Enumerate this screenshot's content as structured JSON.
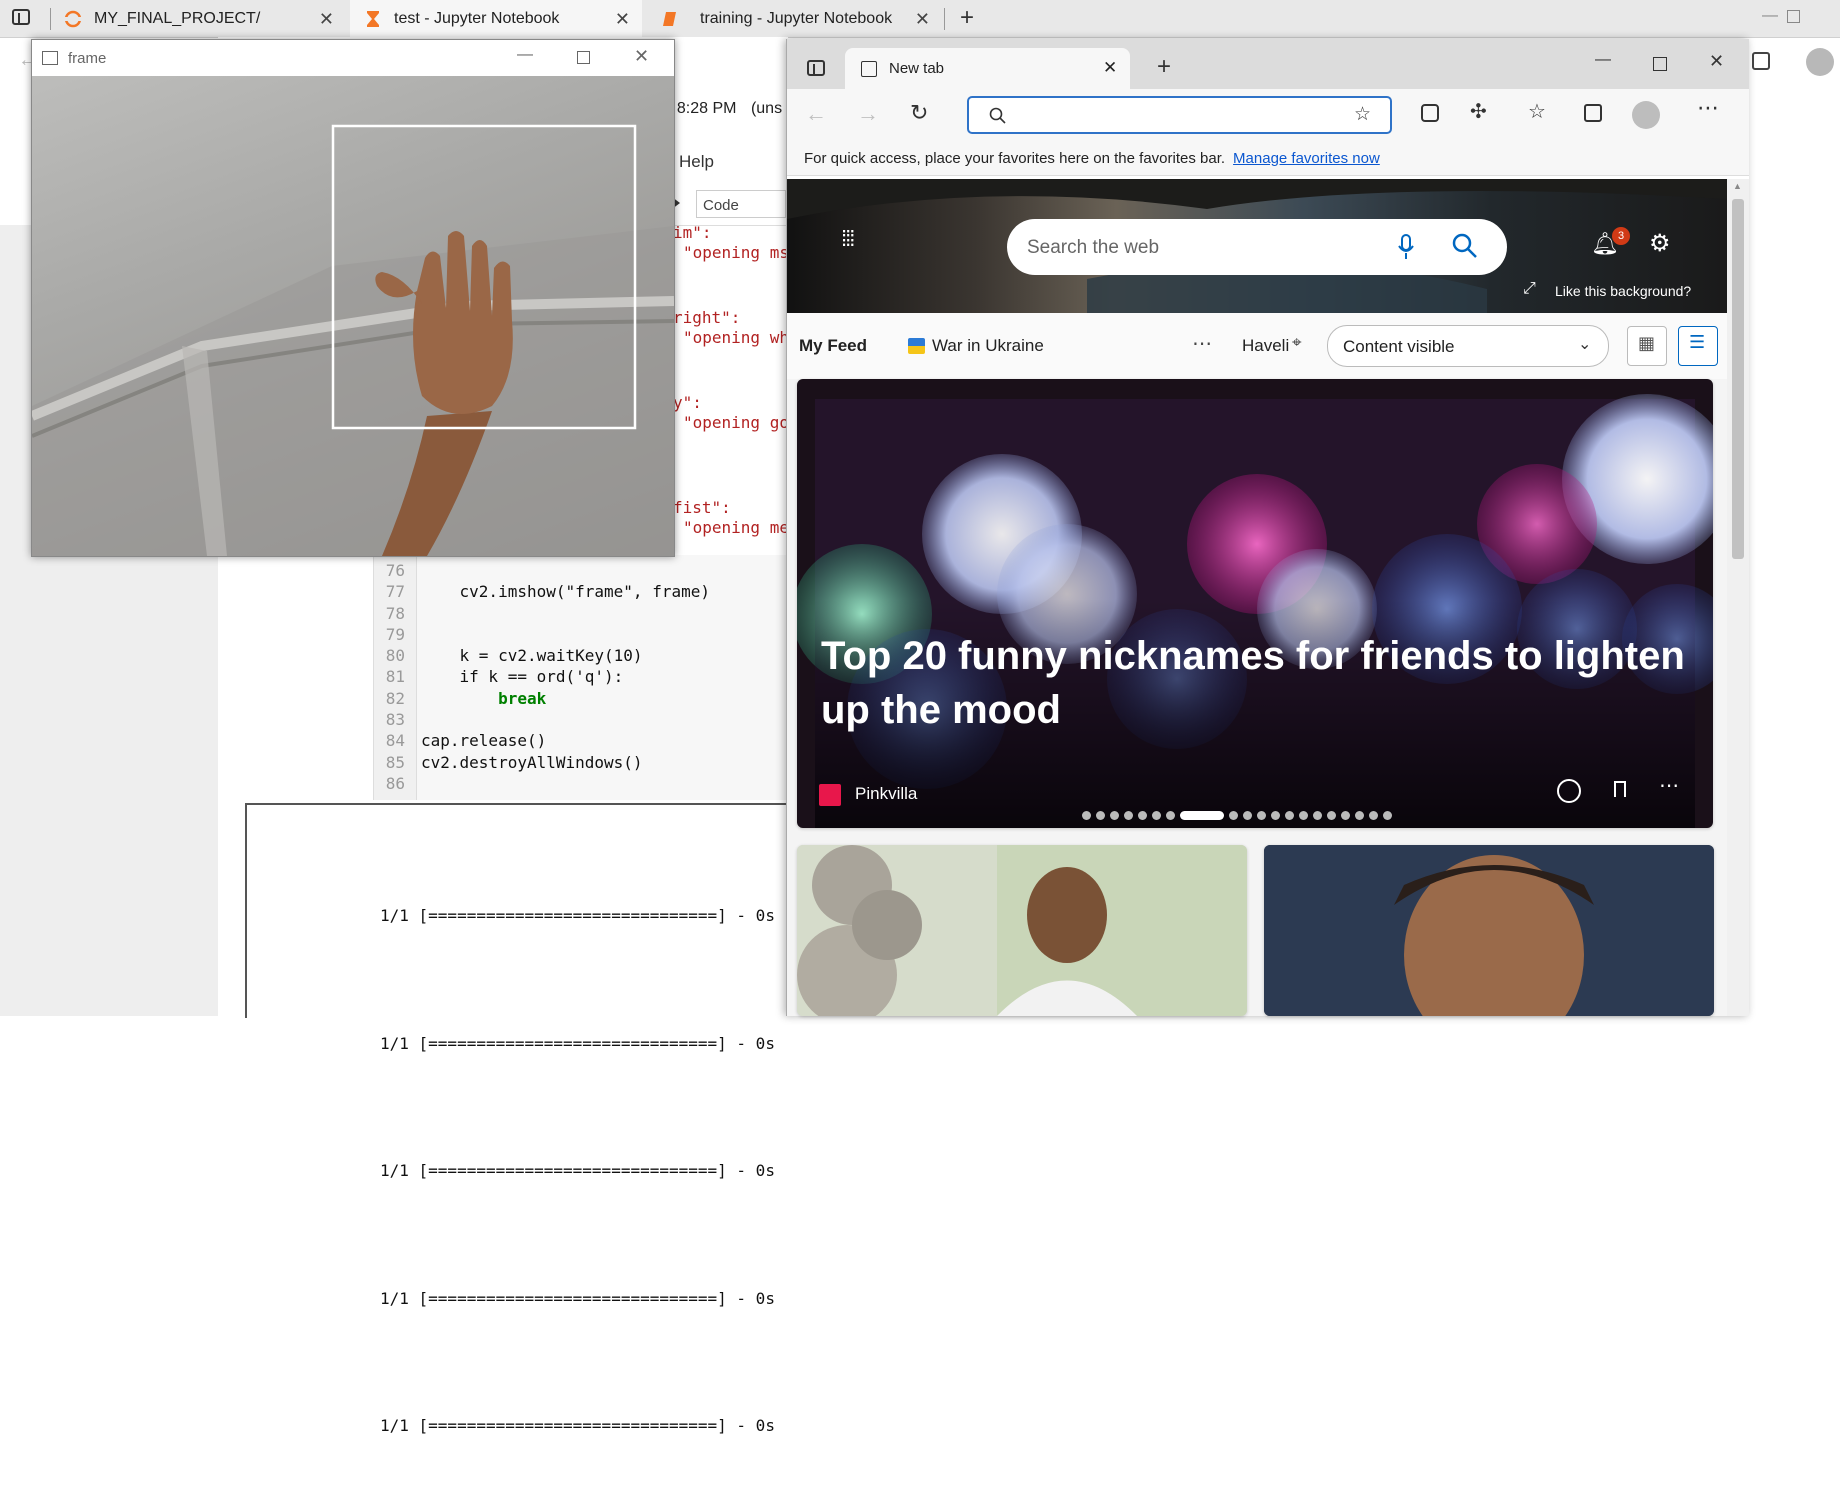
{
  "back_browser": {
    "tabs": [
      {
        "title": "MY_FINAL_PROJECT/"
      },
      {
        "title": "test - Jupyter Notebook"
      },
      {
        "title": "training - Jupyter Notebook"
      }
    ]
  },
  "jupyter": {
    "checkpoint": "t 8:28 PM",
    "checkpoint_suffix": "(uns",
    "menu_help": "Help",
    "cell_type": "Code",
    "code_fragments": [
      {
        "text": "im\":"
      },
      {
        "text": "\"opening ms"
      },
      {
        "text": "right\":"
      },
      {
        "text": "\"opening wh"
      },
      {
        "text": "y\":"
      },
      {
        "text": "\"opening go"
      },
      {
        "text": "fist\":"
      },
      {
        "text": "\"opening me"
      }
    ],
    "code_lines": [
      {
        "num": "76",
        "code": ""
      },
      {
        "num": "77",
        "code": "    cv2.imshow(\"frame\", frame)"
      },
      {
        "num": "78",
        "code": ""
      },
      {
        "num": "79",
        "code": ""
      },
      {
        "num": "80",
        "code": "    k = cv2.waitKey(10)"
      },
      {
        "num": "81",
        "code": "    if k == ord('q'):"
      },
      {
        "num": "82",
        "code": "        break"
      },
      {
        "num": "83",
        "code": ""
      },
      {
        "num": "84",
        "code": "cap.release()"
      },
      {
        "num": "85",
        "code": "cv2.destroyAllWindows()"
      },
      {
        "num": "86",
        "code": ""
      }
    ],
    "output_lines": [
      "1/1 [==============================] - 0s",
      "1/1 [==============================] - 0s",
      "1/1 [==============================] - 0s",
      "1/1 [==============================] - 0s",
      "1/1 [==============================] - 0s"
    ]
  },
  "cv_window": {
    "title": "frame"
  },
  "edge": {
    "tab_title": "New tab",
    "address_value": "",
    "favorites_hint": "For quick access, place your favorites here on the favorites bar.",
    "manage_favorites": "Manage favorites now",
    "search_placeholder": "Search the web",
    "notifications_count": "3",
    "like_background": "Like this background?",
    "feed": {
      "my_feed": "My Feed",
      "topic": "War in Ukraine",
      "location": "Haveli",
      "content_select": "Content visible"
    },
    "hero_article": {
      "headline": "Top 20 funny nicknames for friends to lighten up the mood",
      "source": "Pinkvilla"
    }
  },
  "colors": {
    "link": "#0b57d0",
    "accent": "#0067c0",
    "badge": "#d13a16",
    "pinkvilla": "#e8174b"
  }
}
